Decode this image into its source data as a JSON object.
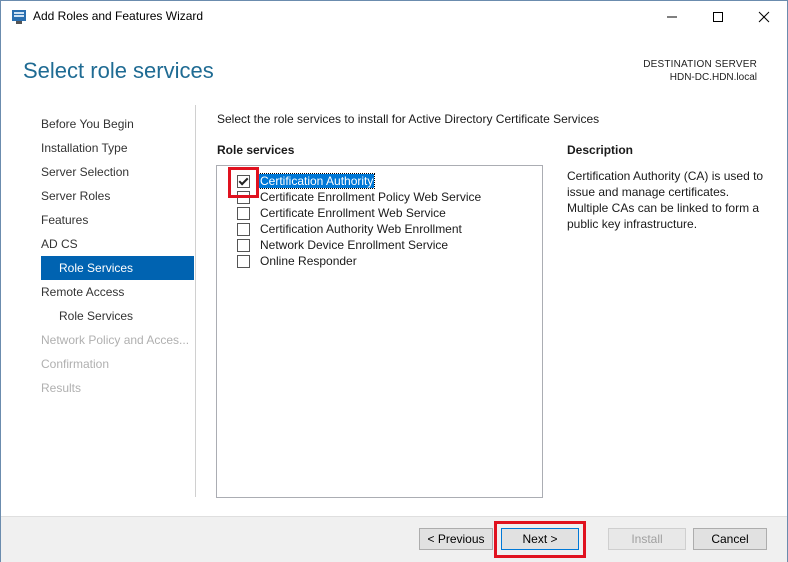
{
  "window": {
    "title": "Add Roles and Features Wizard",
    "minimize_icon": "minimize-icon",
    "maximize_icon": "maximize-icon",
    "close_icon": "close-icon"
  },
  "header": {
    "title": "Select role services",
    "destination_label": "DESTINATION SERVER",
    "destination_server": "HDN-DC.HDN.local"
  },
  "nav": {
    "items": [
      {
        "label": "Before You Begin",
        "state": "normal"
      },
      {
        "label": "Installation Type",
        "state": "normal"
      },
      {
        "label": "Server Selection",
        "state": "normal"
      },
      {
        "label": "Server Roles",
        "state": "normal"
      },
      {
        "label": "Features",
        "state": "normal"
      },
      {
        "label": "AD CS",
        "state": "normal"
      },
      {
        "label": "Role Services",
        "state": "active"
      },
      {
        "label": "Remote Access",
        "state": "normal"
      },
      {
        "label": "Role Services",
        "state": "normal"
      },
      {
        "label": "Network Policy and Acces...",
        "state": "disabled"
      },
      {
        "label": "Confirmation",
        "state": "disabled"
      },
      {
        "label": "Results",
        "state": "disabled"
      }
    ]
  },
  "main": {
    "instruction": "Select the role services to install for Active Directory Certificate Services",
    "role_services_header": "Role services",
    "role_services": [
      {
        "label": "Certification Authority",
        "checked": true,
        "selected": true
      },
      {
        "label": "Certificate Enrollment Policy Web Service",
        "checked": false,
        "selected": false
      },
      {
        "label": "Certificate Enrollment Web Service",
        "checked": false,
        "selected": false
      },
      {
        "label": "Certification Authority Web Enrollment",
        "checked": false,
        "selected": false
      },
      {
        "label": "Network Device Enrollment Service",
        "checked": false,
        "selected": false
      },
      {
        "label": "Online Responder",
        "checked": false,
        "selected": false
      }
    ],
    "description_header": "Description",
    "description_text": "Certification Authority (CA) is used to issue and manage certificates. Multiple CAs can be linked to form a public key infrastructure."
  },
  "footer": {
    "previous_label": "< Previous",
    "next_label": "Next >",
    "install_label": "Install",
    "cancel_label": "Cancel"
  },
  "colors": {
    "accent": "#0063b1",
    "heading": "#1f6b93",
    "highlight": "#e0121f"
  }
}
